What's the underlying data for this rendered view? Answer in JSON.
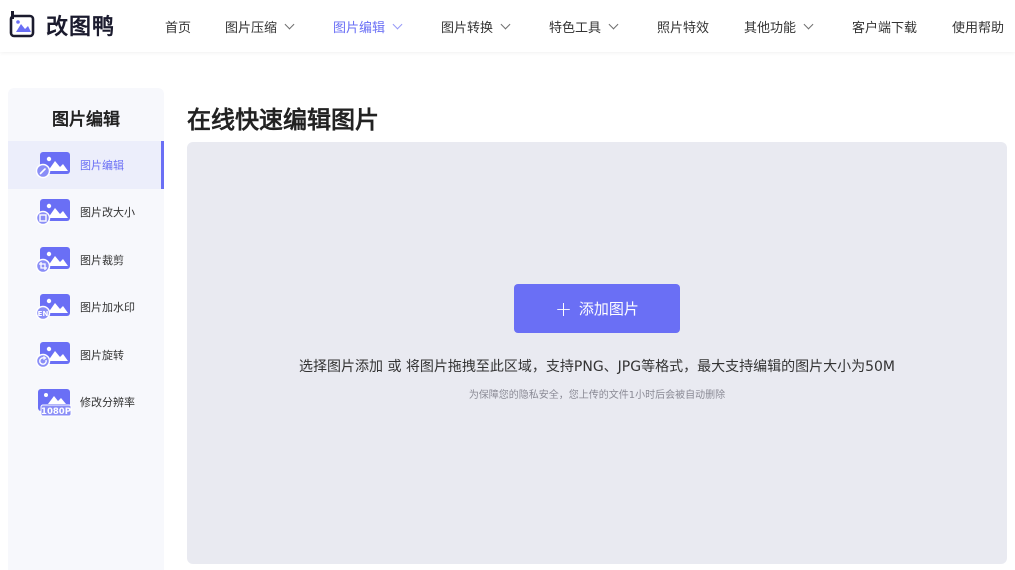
{
  "app": {
    "logo_text": "改图鸭",
    "brand_color": "#6a6ff5"
  },
  "nav": {
    "items": [
      {
        "label": "首页",
        "dropdown": false,
        "active": false
      },
      {
        "label": "图片压缩",
        "dropdown": true,
        "active": false
      },
      {
        "label": "图片编辑",
        "dropdown": true,
        "active": true
      },
      {
        "label": "图片转换",
        "dropdown": true,
        "active": false
      },
      {
        "label": "特色工具",
        "dropdown": true,
        "active": false
      },
      {
        "label": "照片特效",
        "dropdown": false,
        "active": false
      },
      {
        "label": "其他功能",
        "dropdown": true,
        "active": false
      },
      {
        "label": "客户端下载",
        "dropdown": false,
        "active": false
      },
      {
        "label": "使用帮助",
        "dropdown": false,
        "active": false
      }
    ]
  },
  "sidebar": {
    "title": "图片编辑",
    "items": [
      {
        "label": "图片编辑",
        "icon": "image-edit-icon",
        "active": true
      },
      {
        "label": "图片改大小",
        "icon": "image-resize-icon",
        "active": false
      },
      {
        "label": "图片裁剪",
        "icon": "image-crop-icon",
        "active": false
      },
      {
        "label": "图片加水印",
        "icon": "image-watermark-icon",
        "active": false
      },
      {
        "label": "图片旋转",
        "icon": "image-rotate-icon",
        "active": false
      },
      {
        "label": "修改分辨率",
        "icon": "image-resolution-icon",
        "active": false
      }
    ],
    "resolution_badge": "1080P",
    "watermark_badge": "EN"
  },
  "main": {
    "title": "在线快速编辑图片",
    "add_button_label": "添加图片",
    "hint": "选择图片添加 或 将图片拖拽至此区域，支持PNG、JPG等格式，最大支持编辑的图片大小为50M",
    "privacy_note": "为保障您的隐私安全，您上传的文件1小时后会被自动删除"
  }
}
